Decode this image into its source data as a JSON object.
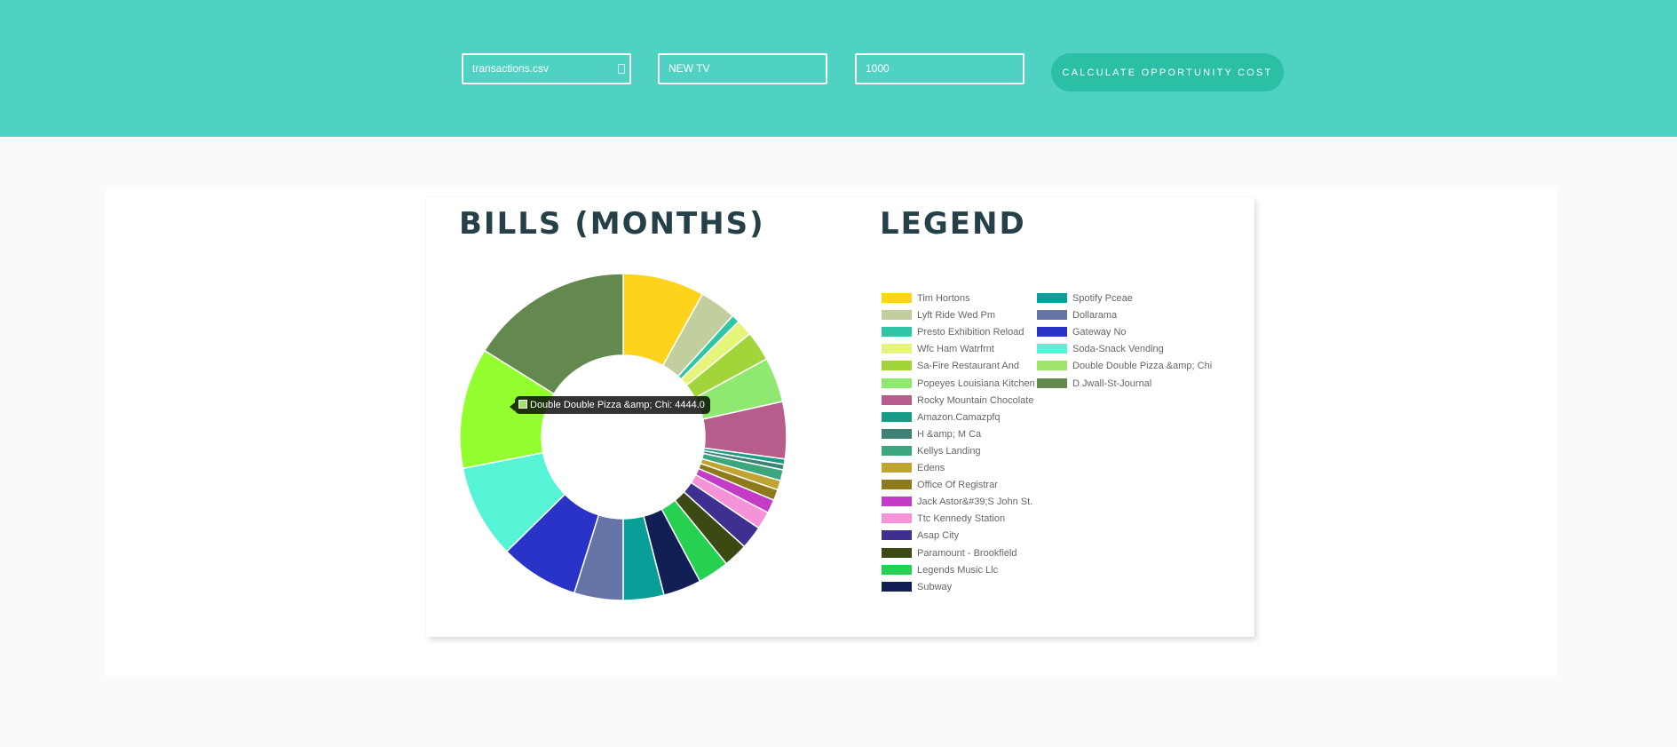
{
  "form": {
    "file_value": "transactions.csv",
    "item_value": "NEW TV",
    "price_value": "1000",
    "button_label": "CALCULATE OPPORTUNITY COST"
  },
  "headings": {
    "chart_title": "BILLS (MONTHS)",
    "legend_title": "LEGEND"
  },
  "tooltip": {
    "text": "Double Double Pizza &amp; Chi: 4444.0",
    "color": "#a0e46a"
  },
  "chart_data": {
    "type": "pie",
    "title": "BILLS (MONTHS)",
    "categories": [
      "Tim Hortons",
      "Lyft Ride Wed Pm",
      "Presto Exhibition Reload",
      "Wfc Ham Watrfrnt",
      "Sa-Fire Restaurant And",
      "Popeyes Louisiana Kitchen",
      "Rocky Mountain Chocolate",
      "Amazon.Camazpfq",
      "H &amp; M Ca",
      "Kellys Landing",
      "Edens",
      "Office Of Registrar",
      "Jack Astor&#39;S John St.",
      "Ttc Kennedy Station",
      "Asap City",
      "Paramount - Brookfield",
      "Legends Music Llc",
      "Subway",
      "Spotify Pceae",
      "Dollarama",
      "Gateway No",
      "Soda-Snack Vending",
      "Double Double Pizza &amp; Chi",
      "D Jwall-St-Journal"
    ],
    "values": [
      3000,
      1350,
      300,
      600,
      1100,
      1650,
      2100,
      200,
      200,
      400,
      350,
      400,
      500,
      650,
      850,
      900,
      1150,
      1400,
      1500,
      1800,
      2900,
      3450,
      4444,
      6000
    ],
    "colors": [
      "#ffd21b",
      "#c1cf9e",
      "#2fc5a5",
      "#e6f47a",
      "#a1d53a",
      "#8fe86f",
      "#b75d8b",
      "#159b86",
      "#3d8274",
      "#3ca77e",
      "#bfa432",
      "#8e7a1b",
      "#c43cc6",
      "#f592d8",
      "#3d3090",
      "#3a4a12",
      "#26d152",
      "#121f55",
      "#0a9e98",
      "#6775a6",
      "#2a33c7",
      "#55f4d6",
      "#94ff2f",
      "#63894f"
    ],
    "legend_columns": [
      [
        "Tim Hortons",
        "Lyft Ride Wed Pm",
        "Presto Exhibition Reload",
        "Wfc Ham Watrfrnt",
        "Sa-Fire Restaurant And",
        "Popeyes Louisiana Kitchen",
        "Rocky Mountain Chocolate",
        "Amazon.Camazpfq",
        "H &amp; M Ca",
        "Kellys Landing",
        "Edens",
        "Office Of Registrar",
        "Jack Astor&#39;S John St.",
        "Ttc Kennedy Station",
        "Asap City",
        "Paramount - Brookfield",
        "Legends Music Llc",
        "Subway"
      ],
      [
        "Spotify Pceae",
        "Dollarama",
        "Gateway No",
        "Soda-Snack Vending",
        "Double Double Pizza &amp; Chi",
        "D Jwall-St-Journal"
      ]
    ],
    "legend_colors": [
      [
        "#ffd21b",
        "#c1cf9e",
        "#2fc5a5",
        "#e6f47a",
        "#a1d53a",
        "#8fe86f",
        "#b75d8b",
        "#159b86",
        "#3d8274",
        "#3ca77e",
        "#bfa432",
        "#8e7a1b",
        "#c43cc6",
        "#f592d8",
        "#3d3090",
        "#3a4a12",
        "#26d152",
        "#121f55"
      ],
      [
        "#0a9e98",
        "#6775a6",
        "#2a33c7",
        "#55f4d6",
        "#a0e46a",
        "#63894f"
      ]
    ],
    "legend_placement": "right"
  }
}
